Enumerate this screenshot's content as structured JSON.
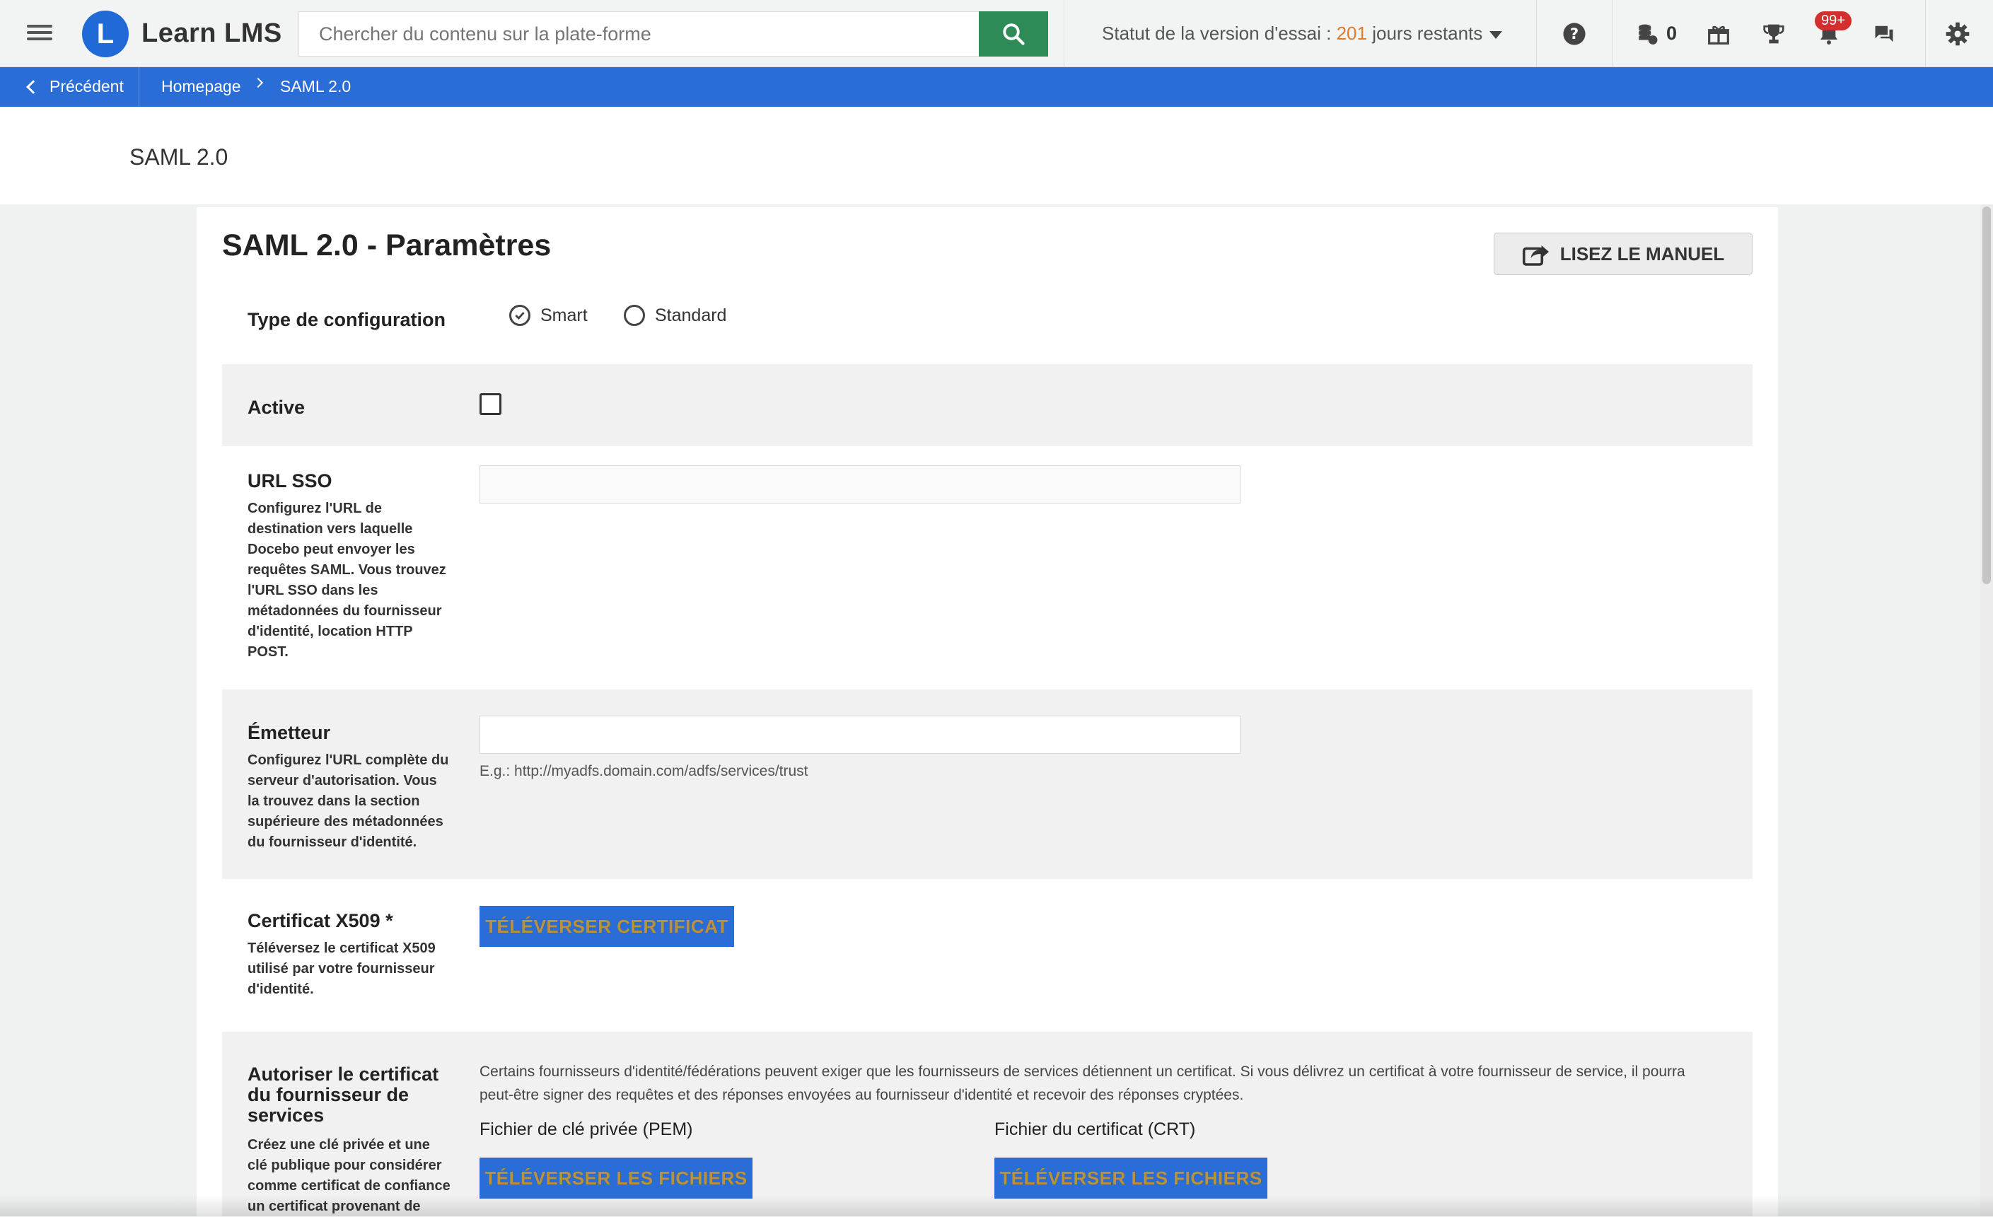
{
  "header": {
    "logo_letter": "L",
    "app_name": "Learn LMS",
    "search_placeholder": "Chercher du contenu sur la plate-forme",
    "trial_prefix": "Statut de la version d'essai : ",
    "trial_days": "201",
    "trial_suffix": " jours restants",
    "coins_count": "0",
    "notifications_badge": "99+",
    "icons": [
      "menu-icon",
      "search-icon",
      "help-icon",
      "coins-icon",
      "gift-icon",
      "trophy-icon",
      "bell-icon",
      "chat-icon",
      "gear-icon"
    ],
    "accent_color": "#2e8b57",
    "trial_days_color": "#e07b2a"
  },
  "breadcrumb": {
    "back_label": "Précédent",
    "home_label": "Homepage",
    "current_label": "SAML 2.0",
    "bar_color": "#2a6dd6"
  },
  "page": {
    "title": "SAML 2.0"
  },
  "card": {
    "title": "SAML 2.0 - Paramètres",
    "manual_button": "LISEZ LE MANUEL",
    "config_type": {
      "label": "Type de configuration",
      "options": [
        "Smart",
        "Standard"
      ],
      "selected": "Smart"
    },
    "active": {
      "label": "Active",
      "checked": false
    },
    "sso_url": {
      "label": "URL SSO",
      "description": "Configurez l'URL de destination vers laquelle Docebo peut envoyer les requêtes SAML. Vous trouvez l'URL SSO dans les métadonnées du fournisseur d'identité, location HTTP POST.",
      "value": ""
    },
    "issuer": {
      "label": "Émetteur",
      "description": "Configurez l'URL complète du serveur d'autorisation. Vous la trouvez dans la section supérieure des métadonnées du fournisseur d'identité.",
      "value": "",
      "hint": "E.g.: http://myadfs.domain.com/adfs/services/trust"
    },
    "certificate": {
      "label": "Certificat X509 *",
      "description": "Téléversez le certificat X509 utilisé par votre fournisseur d'identité.",
      "button": "TÉLÉVERSER CERTIFICAT"
    },
    "sp_cert": {
      "label": "Autoriser le certificat du fournisseur de services",
      "description": "Créez une clé privée et une clé publique pour considérer comme certificat de confiance un certificat provenant de",
      "info": "Certains fournisseurs d'identité/fédérations peuvent exiger que les fournisseurs de services détiennent un certificat. Si vous délivrez un certificat à votre fournisseur de service, il pourra peut-être signer des requêtes et des réponses envoyées au fournisseur d'identité et recevoir des réponses cryptées.",
      "private_key_label": "Fichier de clé privée (PEM)",
      "private_key_button": "TÉLÉVERSER LES FICHIERS",
      "crt_label": "Fichier du certificat (CRT)",
      "crt_button": "TÉLÉVERSER LES FICHIERS"
    }
  }
}
